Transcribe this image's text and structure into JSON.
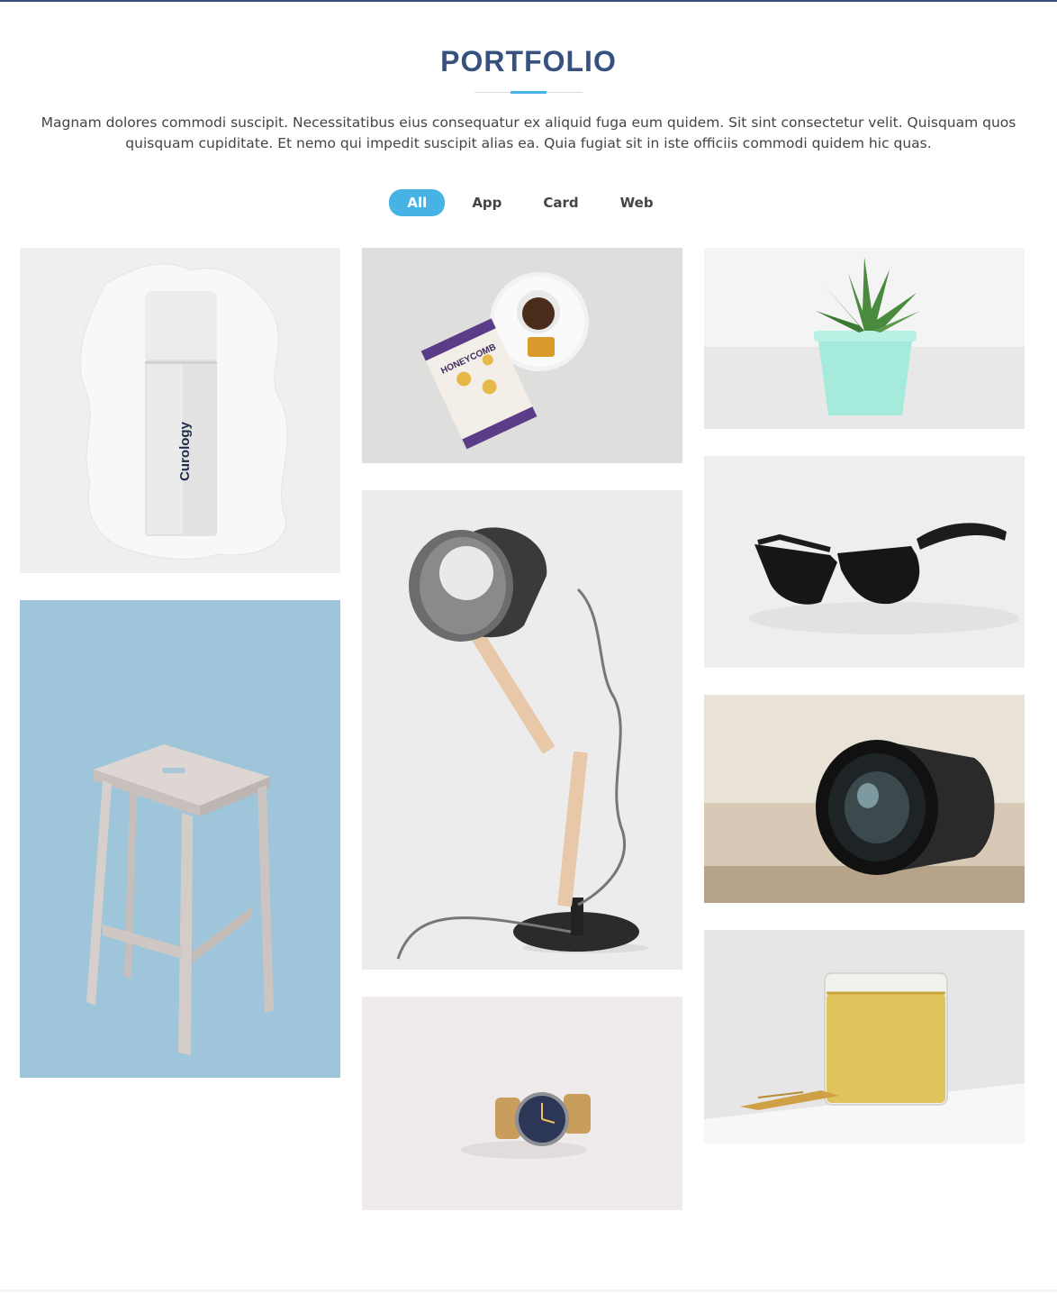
{
  "section": {
    "title": "PORTFOLIO",
    "description": "Magnam dolores commodi suscipit. Necessitatibus eius consequatur ex aliquid fuga eum quidem. Sit sint consectetur velit. Quisquam quos quisquam cupiditate. Et nemo qui impedit suscipit alias ea. Quia fugiat sit in iste officiis commodi quidem hic quas."
  },
  "filters": [
    {
      "label": "All",
      "active": true
    },
    {
      "label": "App",
      "active": false
    },
    {
      "label": "Card",
      "active": false
    },
    {
      "label": "Web",
      "active": false
    }
  ],
  "items": {
    "bottle_brand": "Curology",
    "honey_brand": "HONEYCOMB"
  },
  "colors": {
    "primary": "#37517e",
    "accent": "#47b2e4",
    "text": "#444444"
  }
}
